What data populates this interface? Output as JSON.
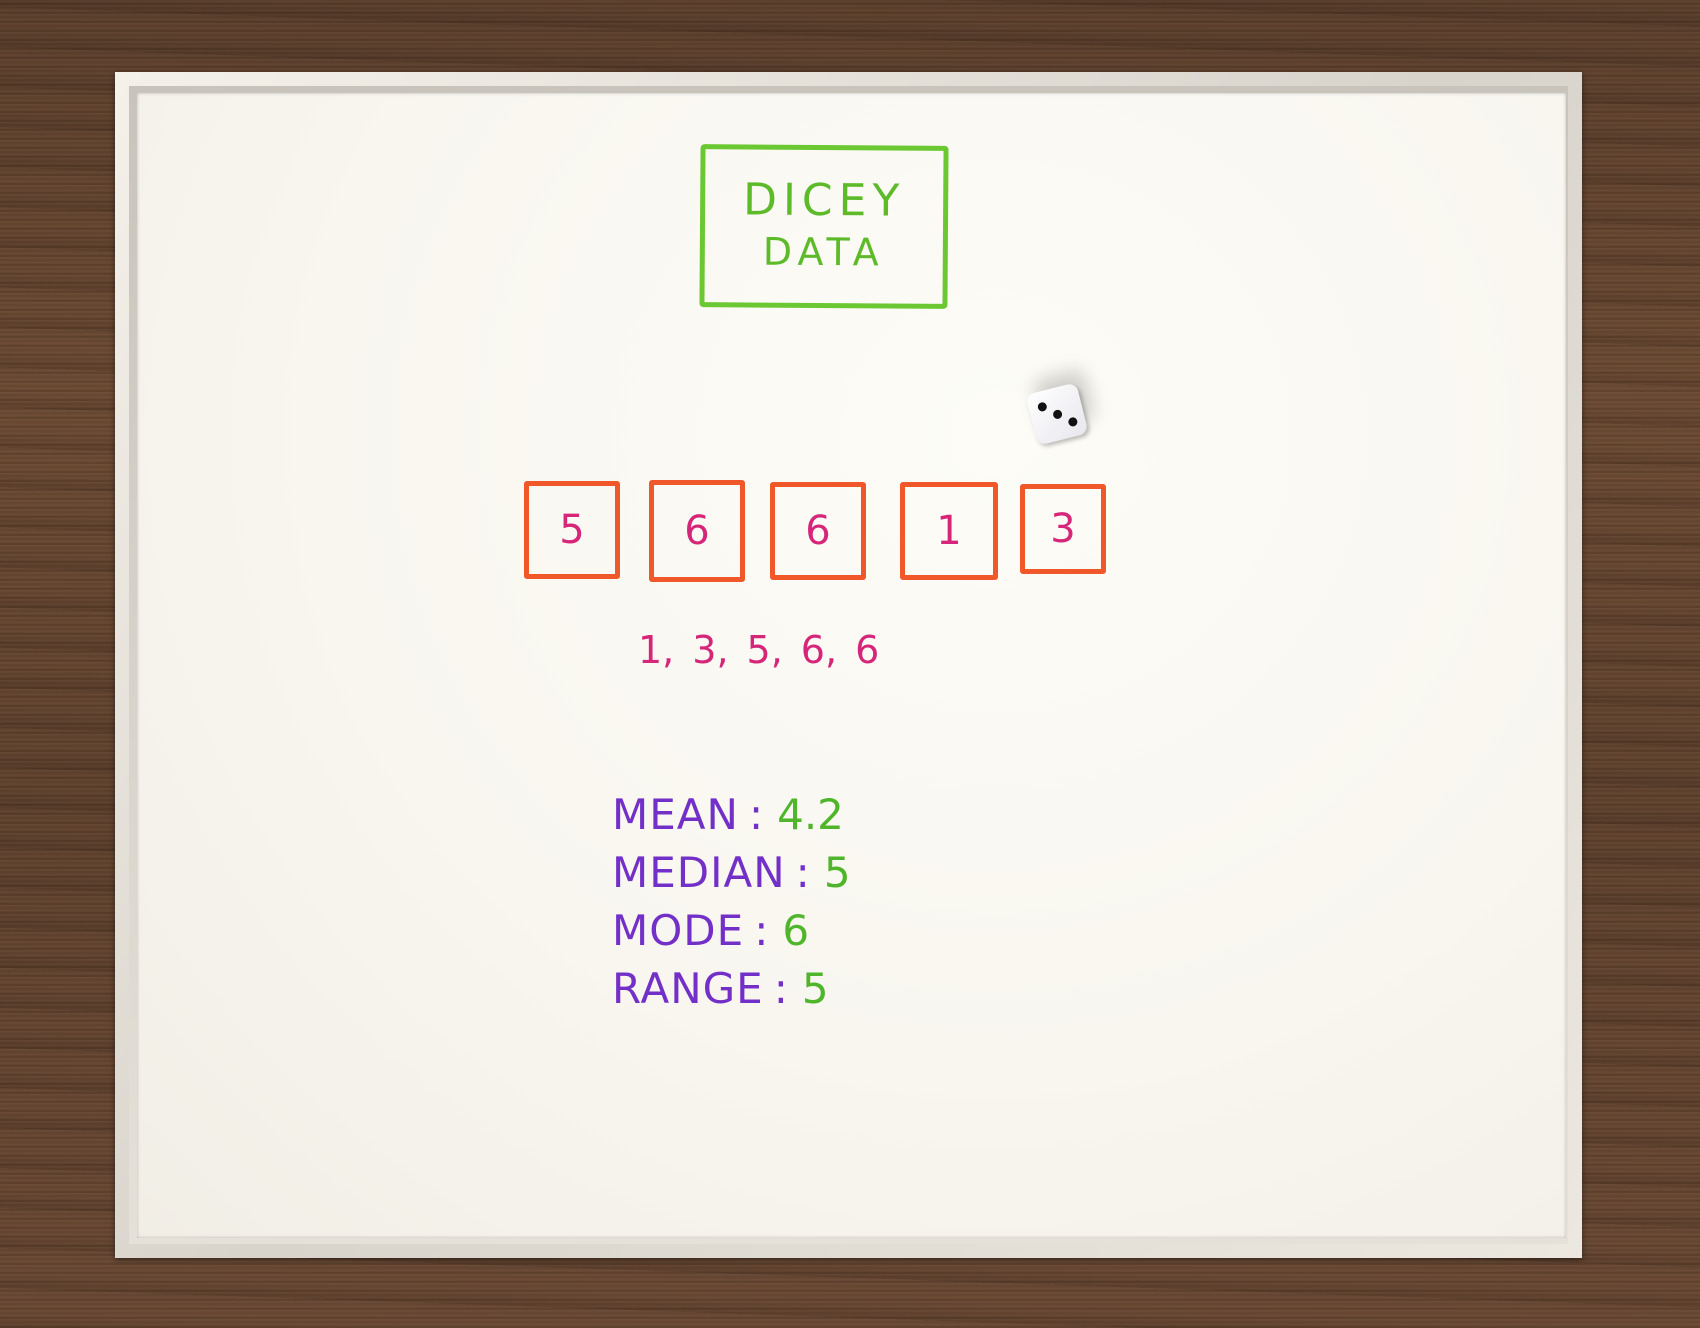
{
  "scene": "whiteboard on wooden table",
  "colors": {
    "title_marker": "#6cc832",
    "box_marker": "#f0582a",
    "number_marker": "#d6267a",
    "label_marker": "#7330c8",
    "value_marker": "#4fb52a",
    "wood": "#5e412d"
  },
  "title": {
    "line1": "DICEY",
    "line2": "DATA"
  },
  "die": {
    "top_face": 3
  },
  "rolls": [
    "5",
    "6",
    "6",
    "1",
    "3"
  ],
  "sorted": [
    "1,",
    "3,",
    "5,",
    "6,",
    "6"
  ],
  "stats": [
    {
      "label": "MEAN",
      "value": "4.2"
    },
    {
      "label": "MEDIAN",
      "value": "5"
    },
    {
      "label": "MODE",
      "value": "6"
    },
    {
      "label": "RANGE",
      "value": "5"
    }
  ]
}
